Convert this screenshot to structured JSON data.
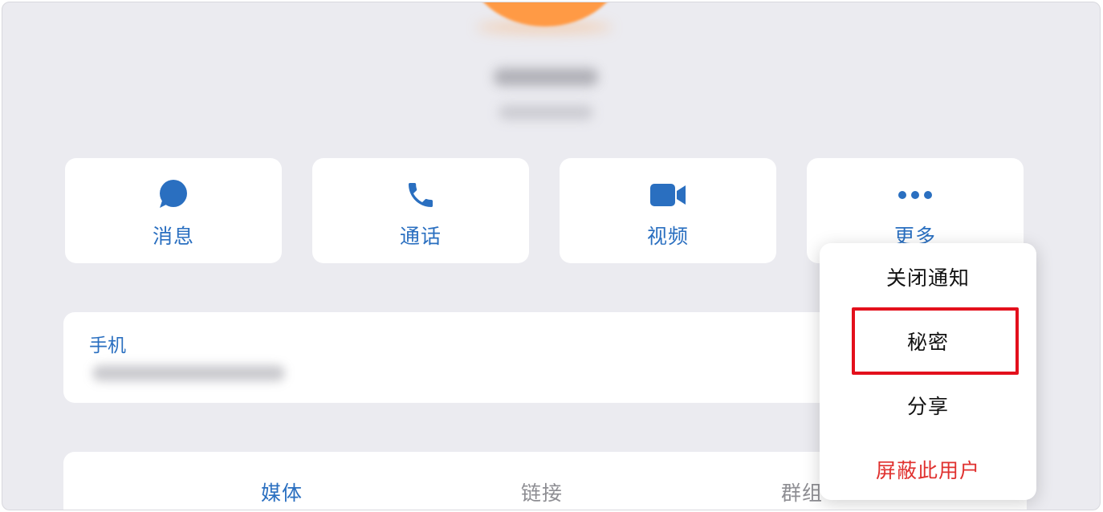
{
  "profile": {
    "name": "",
    "subtitle": ""
  },
  "actions": [
    {
      "label": "消息",
      "icon": "chat-bubble-icon"
    },
    {
      "label": "通话",
      "icon": "phone-icon"
    },
    {
      "label": "视频",
      "icon": "video-camera-icon"
    },
    {
      "label": "更多",
      "icon": "more-dots-icon"
    }
  ],
  "phone": {
    "label": "手机",
    "value": ""
  },
  "tabs": [
    {
      "label": "媒体",
      "active": true
    },
    {
      "label": "链接",
      "active": false
    },
    {
      "label": "群组",
      "active": false
    }
  ],
  "menu": {
    "items": [
      {
        "label": "关闭通知"
      },
      {
        "label": "秘密",
        "highlighted": true
      },
      {
        "label": "分享"
      },
      {
        "label": "屏蔽此用户",
        "danger": true
      }
    ]
  },
  "colors": {
    "accent": "#2a6fc0",
    "danger": "#e0312f",
    "highlight": "#e3101c",
    "avatar": "#ff9a45",
    "background": "#ebebf0"
  }
}
